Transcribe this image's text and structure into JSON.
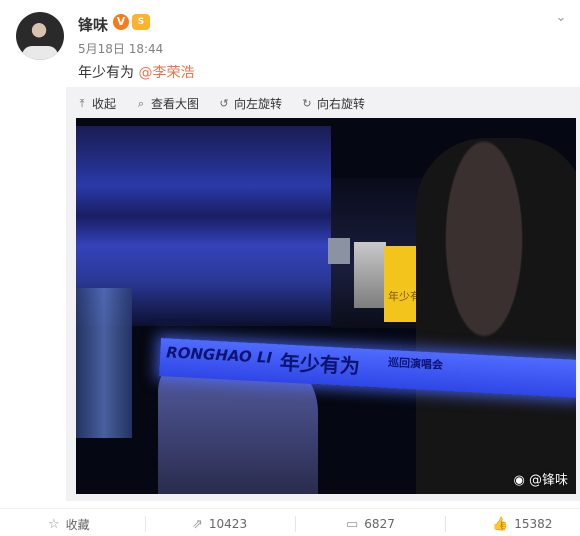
{
  "post": {
    "author": "锋味",
    "verified_badge": "V",
    "level_badge": "S",
    "meta": "5月18日 18:44",
    "text": "年少有为",
    "mention": "@李荣浩"
  },
  "toolbar": {
    "collapse": "收起",
    "view_large": "查看大图",
    "rotate_left": "向左旋转",
    "rotate_right": "向右旋转"
  },
  "photo": {
    "glowstick_brand": "RONGHAO LI",
    "glowstick_title": "年少有为",
    "glowstick_sub": "巡回演唱会",
    "screen_text": "年少有为",
    "watermark": "@锋味"
  },
  "actions": {
    "favorite": "收藏",
    "repost_count": "10423",
    "comment_count": "6827",
    "like_count": "15382"
  },
  "colors": {
    "mention": "#eb7350",
    "vbadge": "#f77b1a",
    "lvbadge": "#ffb22b"
  }
}
